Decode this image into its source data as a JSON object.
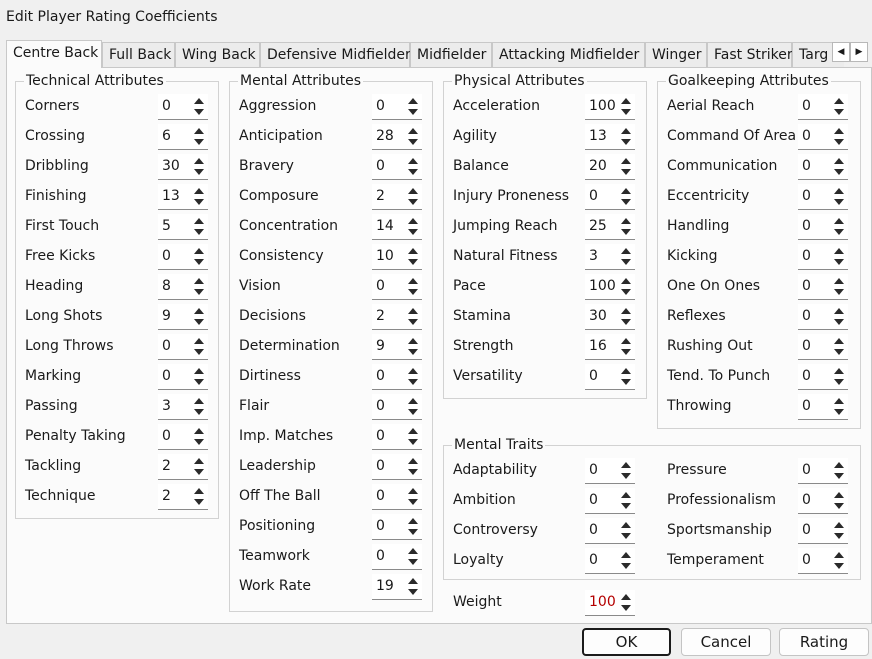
{
  "window": {
    "title": "Edit Player Rating Coefficients"
  },
  "tabs": [
    {
      "label": "Centre Back",
      "active": true
    },
    {
      "label": "Full Back"
    },
    {
      "label": "Wing Back"
    },
    {
      "label": "Defensive Midfielder"
    },
    {
      "label": "Midfielder"
    },
    {
      "label": "Attacking Midfielder"
    },
    {
      "label": "Winger"
    },
    {
      "label": "Fast Striker"
    },
    {
      "label": "Targ"
    }
  ],
  "tab_scroll": {
    "left_icon": "◀",
    "right_icon": "▶"
  },
  "technical": {
    "title": "Technical Attributes",
    "items": [
      {
        "label": "Corners",
        "value": "0"
      },
      {
        "label": "Crossing",
        "value": "6"
      },
      {
        "label": "Dribbling",
        "value": "30"
      },
      {
        "label": "Finishing",
        "value": "13"
      },
      {
        "label": "First Touch",
        "value": "5"
      },
      {
        "label": "Free Kicks",
        "value": "0"
      },
      {
        "label": "Heading",
        "value": "8"
      },
      {
        "label": "Long Shots",
        "value": "9"
      },
      {
        "label": "Long Throws",
        "value": "0"
      },
      {
        "label": "Marking",
        "value": "0"
      },
      {
        "label": "Passing",
        "value": "3"
      },
      {
        "label": "Penalty Taking",
        "value": "0"
      },
      {
        "label": "Tackling",
        "value": "2"
      },
      {
        "label": "Technique",
        "value": "2"
      }
    ]
  },
  "mental": {
    "title": "Mental Attributes",
    "items": [
      {
        "label": "Aggression",
        "value": "0"
      },
      {
        "label": "Anticipation",
        "value": "28"
      },
      {
        "label": "Bravery",
        "value": "0"
      },
      {
        "label": "Composure",
        "value": "2"
      },
      {
        "label": "Concentration",
        "value": "14"
      },
      {
        "label": "Consistency",
        "value": "10"
      },
      {
        "label": "Vision",
        "value": "0"
      },
      {
        "label": "Decisions",
        "value": "2"
      },
      {
        "label": "Determination",
        "value": "9"
      },
      {
        "label": "Dirtiness",
        "value": "0"
      },
      {
        "label": "Flair",
        "value": "0"
      },
      {
        "label": "Imp. Matches",
        "value": "0"
      },
      {
        "label": "Leadership",
        "value": "0"
      },
      {
        "label": "Off The Ball",
        "value": "0"
      },
      {
        "label": "Positioning",
        "value": "0"
      },
      {
        "label": "Teamwork",
        "value": "0"
      },
      {
        "label": "Work Rate",
        "value": "19"
      }
    ]
  },
  "physical": {
    "title": "Physical Attributes",
    "items": [
      {
        "label": "Acceleration",
        "value": "100"
      },
      {
        "label": "Agility",
        "value": "13"
      },
      {
        "label": "Balance",
        "value": "20"
      },
      {
        "label": "Injury Proneness",
        "value": "0"
      },
      {
        "label": "Jumping Reach",
        "value": "25"
      },
      {
        "label": "Natural Fitness",
        "value": "3"
      },
      {
        "label": "Pace",
        "value": "100"
      },
      {
        "label": "Stamina",
        "value": "30"
      },
      {
        "label": "Strength",
        "value": "16"
      },
      {
        "label": "Versatility",
        "value": "0"
      }
    ]
  },
  "goalkeeping": {
    "title": "Goalkeeping Attributes",
    "items": [
      {
        "label": "Aerial Reach",
        "value": "0"
      },
      {
        "label": "Command Of Area",
        "value": "0"
      },
      {
        "label": "Communication",
        "value": "0"
      },
      {
        "label": "Eccentricity",
        "value": "0"
      },
      {
        "label": "Handling",
        "value": "0"
      },
      {
        "label": "Kicking",
        "value": "0"
      },
      {
        "label": "One On Ones",
        "value": "0"
      },
      {
        "label": "Reflexes",
        "value": "0"
      },
      {
        "label": "Rushing Out",
        "value": "0"
      },
      {
        "label": "Tend. To Punch",
        "value": "0"
      },
      {
        "label": "Throwing",
        "value": "0"
      }
    ]
  },
  "traits": {
    "title": "Mental Traits",
    "left": [
      {
        "label": "Adaptability",
        "value": "0"
      },
      {
        "label": "Ambition",
        "value": "0"
      },
      {
        "label": "Controversy",
        "value": "0"
      },
      {
        "label": "Loyalty",
        "value": "0"
      }
    ],
    "right": [
      {
        "label": "Pressure",
        "value": "0"
      },
      {
        "label": "Professionalism",
        "value": "0"
      },
      {
        "label": "Sportsmanship",
        "value": "0"
      },
      {
        "label": "Temperament",
        "value": "0"
      }
    ]
  },
  "weight": {
    "label": "Weight",
    "value": "100",
    "value_color": "#b40000"
  },
  "buttons": {
    "ok": "OK",
    "cancel": "Cancel",
    "rating": "Rating"
  }
}
